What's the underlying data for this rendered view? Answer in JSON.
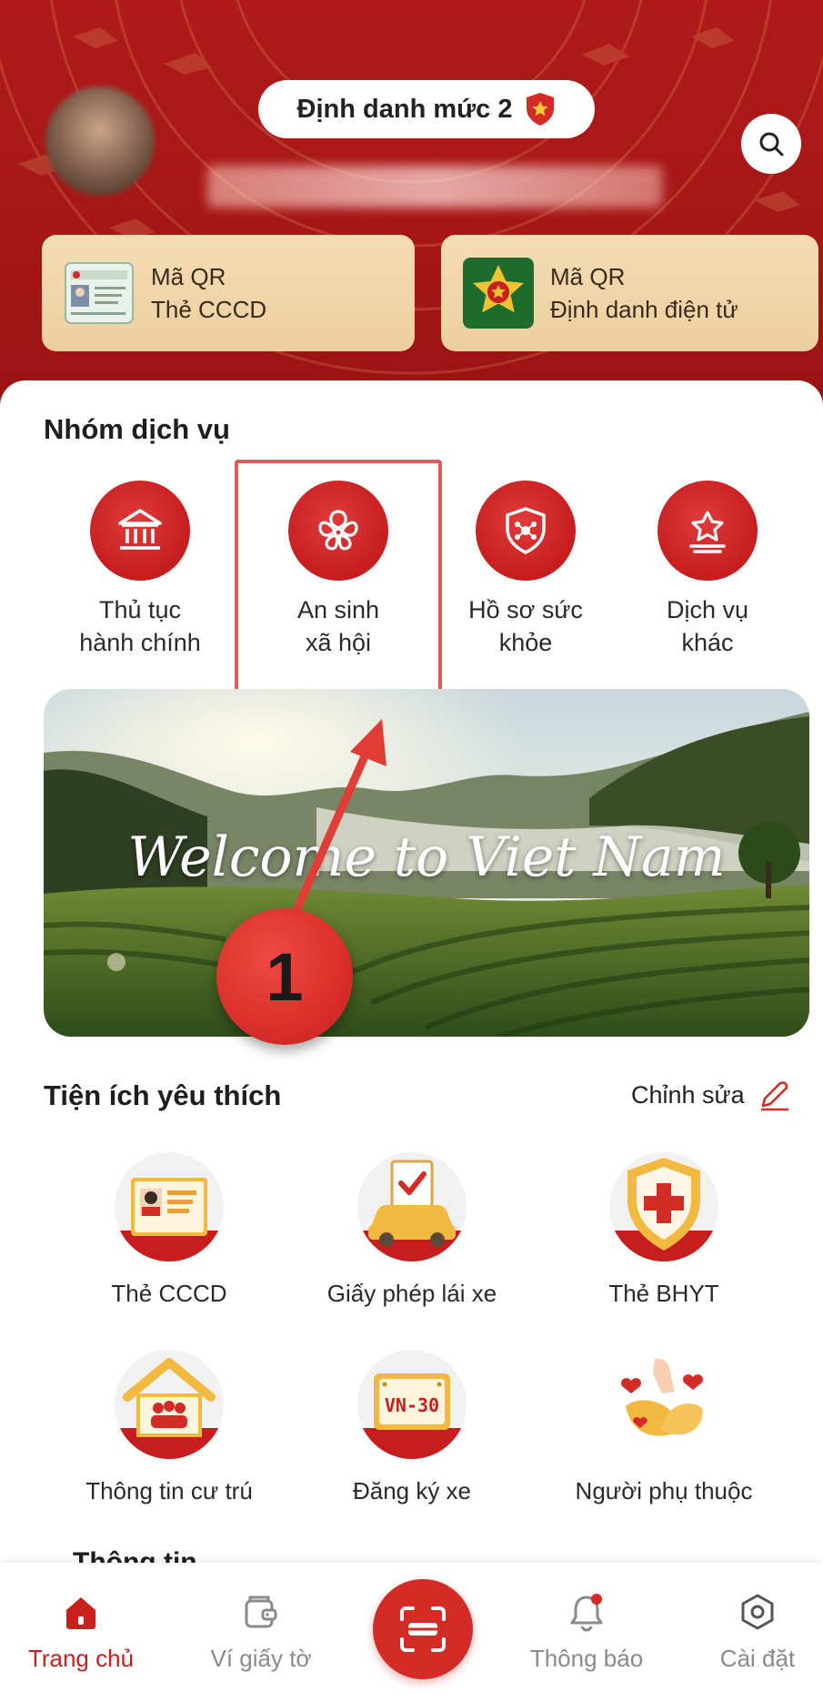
{
  "header": {
    "level_badge": "Định danh mức 2",
    "qr_cards": [
      {
        "line1": "Mã QR",
        "line2": "Thẻ CCCD"
      },
      {
        "line1": "Mã QR",
        "line2": "Định danh điện tử"
      }
    ]
  },
  "services": {
    "title": "Nhóm dịch vụ",
    "items": [
      {
        "label": "Thủ tục\nhành chính",
        "icon": "bank-icon"
      },
      {
        "label": "An sinh\nxã hội",
        "icon": "flower-icon"
      },
      {
        "label": "Hồ sơ sức\nkhỏe",
        "icon": "health-shield-icon"
      },
      {
        "label": "Dịch vụ\nkhác",
        "icon": "star-icon"
      }
    ]
  },
  "banner": {
    "text": "Welcome to Viet Nam"
  },
  "annotation": {
    "step": "1"
  },
  "favorites": {
    "title": "Tiện ích yêu thích",
    "edit_label": "Chỉnh sửa",
    "items": [
      {
        "label": "Thẻ CCCD",
        "icon": "id-card-icon"
      },
      {
        "label": "Giấy phép lái xe",
        "icon": "driver-license-icon"
      },
      {
        "label": "Thẻ BHYT",
        "icon": "health-insurance-icon"
      },
      {
        "label": "Thông tin cư trú",
        "icon": "residence-icon"
      },
      {
        "label": "Đăng ký xe",
        "icon": "license-plate-icon"
      },
      {
        "label": "Người phụ thuộc",
        "icon": "dependents-icon"
      }
    ],
    "plate_text": "VN-30"
  },
  "next_section_title": "Thông tin",
  "bottom_nav": {
    "items": [
      {
        "label": "Trang chủ",
        "icon": "home-icon",
        "active": true
      },
      {
        "label": "Ví giấy tờ",
        "icon": "wallet-icon",
        "active": false
      },
      {
        "label": "",
        "icon": "scan-icon",
        "active": false
      },
      {
        "label": "Thông báo",
        "icon": "bell-icon",
        "active": false
      },
      {
        "label": "Cài đặt",
        "icon": "settings-icon",
        "active": false
      }
    ]
  },
  "colors": {
    "primary_red": "#c8201d",
    "header_red": "#b01a1a",
    "card_gold": "#f4dcb3"
  }
}
